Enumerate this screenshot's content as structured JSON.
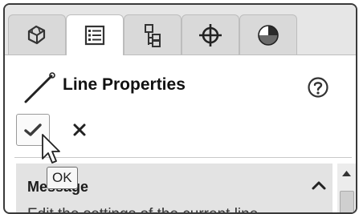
{
  "tabs": [
    {
      "icon": "feature-manager-icon",
      "active": false
    },
    {
      "icon": "property-manager-icon",
      "active": true
    },
    {
      "icon": "configuration-manager-icon",
      "active": false
    },
    {
      "icon": "dimxpert-manager-icon",
      "active": false
    },
    {
      "icon": "display-manager-icon",
      "active": false
    }
  ],
  "header": {
    "title": "Line Properties",
    "icon": "line-icon",
    "help_icon": "help-icon"
  },
  "actions": {
    "ok_icon": "checkmark-icon",
    "cancel_icon": "close-icon",
    "tooltip": "OK"
  },
  "message": {
    "title": "Message",
    "text": "Edit the settings of the current line",
    "collapse_icon": "chevron-up-icon"
  },
  "colors": {
    "tab_bar": "#e6e6e6",
    "panel": "#e3e3e3",
    "text": "#222222"
  }
}
